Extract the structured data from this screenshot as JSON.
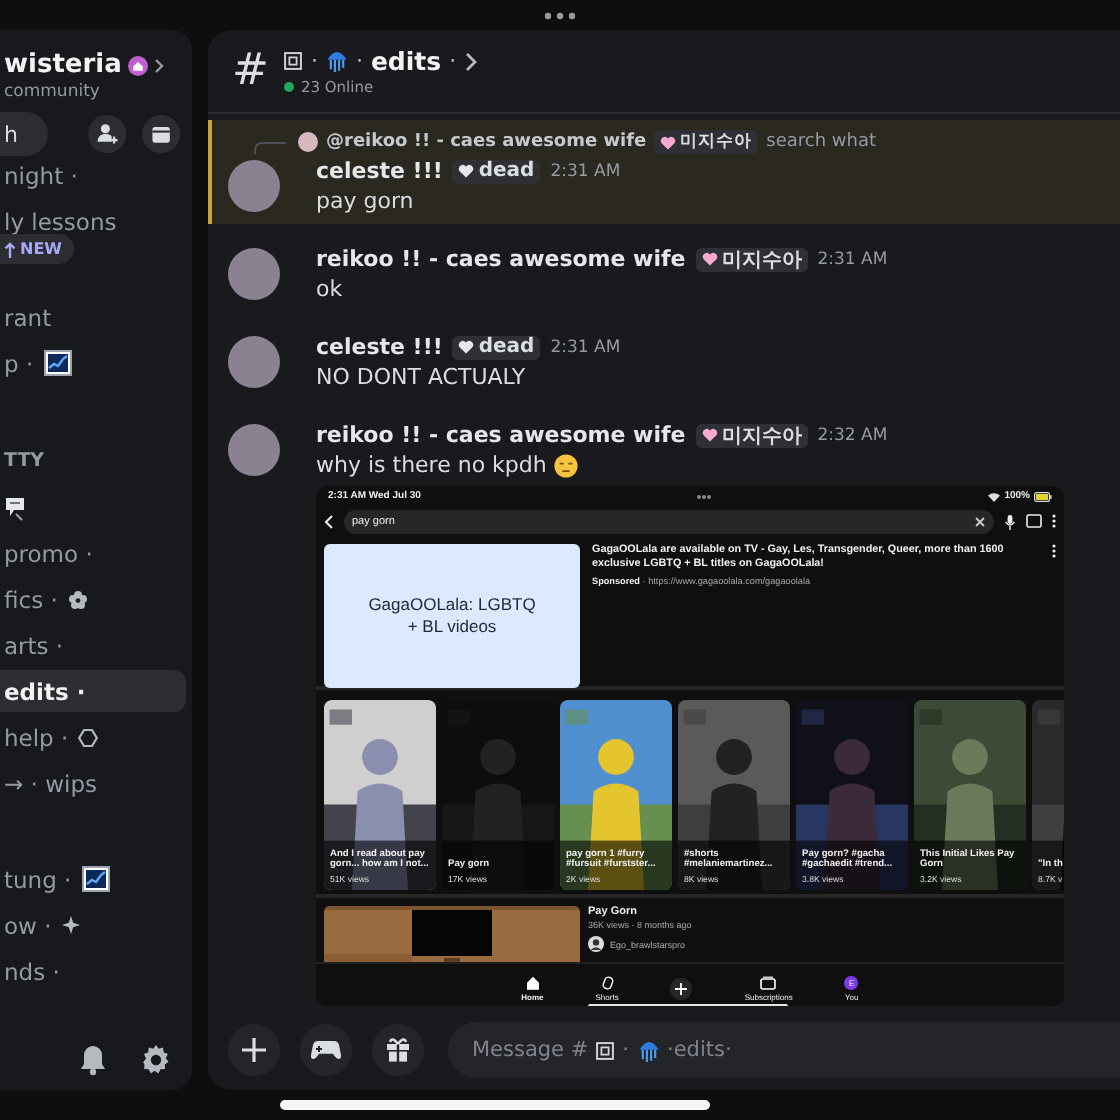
{
  "sidebar": {
    "server_name": "wisteria",
    "server_subtitle": "community",
    "search_label": "h",
    "new_badge": "NEW",
    "groups": [
      {
        "items": [
          {
            "kind": "text",
            "label": "night ·",
            "selected": false
          },
          {
            "kind": "text",
            "label": "ly lessons",
            "selected": false
          }
        ]
      },
      {
        "items": [
          {
            "kind": "text",
            "label": "rant",
            "selected": false
          },
          {
            "kind": "chart",
            "label": "p ·",
            "selected": false
          }
        ]
      },
      {
        "category": "TTY",
        "items": [
          {
            "kind": "sticker",
            "selected": false
          },
          {
            "kind": "text",
            "label": "promo ·",
            "selected": false
          },
          {
            "kind": "flower",
            "label": "fics ·",
            "selected": false
          },
          {
            "kind": "text",
            "label": "arts ·",
            "selected": false
          },
          {
            "kind": "text",
            "label": "edits ·",
            "selected": true
          },
          {
            "kind": "hexagon",
            "label": "help ·",
            "selected": false
          },
          {
            "kind": "text",
            "label": "→ · wips",
            "selected": false
          }
        ]
      },
      {
        "items": [
          {
            "kind": "chart",
            "label": "tung ·",
            "selected": false
          },
          {
            "kind": "sparkle",
            "label": "ow ·",
            "selected": false
          },
          {
            "kind": "text",
            "label": "nds ·",
            "selected": false
          }
        ]
      }
    ]
  },
  "header": {
    "hash": "#",
    "title_parts": [
      {
        "kind": "square"
      },
      {
        "kind": "text",
        "text": "·"
      },
      {
        "kind": "jellyfish"
      },
      {
        "kind": "text",
        "text": "·"
      },
      {
        "kind": "strong",
        "text": "edits"
      },
      {
        "kind": "text",
        "text": "·"
      },
      {
        "kind": "chevron"
      }
    ],
    "online": "23 Online"
  },
  "messages": [
    {
      "author": "celeste !!!",
      "tag": {
        "text": "dead",
        "color": "#e5e7eb"
      },
      "time": "2:31 AM",
      "text": "pay gorn",
      "highlighted": true,
      "reply": {
        "author": "@reikoo !! - caes awesome wife",
        "tag": {
          "text": "미지수아",
          "color": "#f9a8d4"
        },
        "text": "search what"
      }
    },
    {
      "author": "reikoo !! - caes awesome wife",
      "tag": {
        "text": "미지수아",
        "color": "#f9a8d4"
      },
      "time": "2:31 AM",
      "text": "ok",
      "highlighted": false
    },
    {
      "author": "celeste !!!",
      "tag": {
        "text": "dead",
        "color": "#e5e7eb"
      },
      "time": "2:31 AM",
      "text": "NO DONT ACTUALY",
      "highlighted": false
    },
    {
      "author": "reikoo !! - caes awesome wife",
      "tag": {
        "text": "미지수아",
        "color": "#f9a8d4"
      },
      "time": "2:32 AM",
      "text": "why is there no kpdh",
      "trailing_emoji": true,
      "highlighted": false,
      "attachment": {
        "status_time": "2:31 AM  Wed Jul 30",
        "battery": "100%",
        "search_query": "pay gorn",
        "ad": {
          "thumb_text": "GagaOOLala: LGBTQ + BL videos",
          "title": "GagaOOLala are available on TV - Gay, Les, Transgender, Queer, more than 1600 exclusive LGBTQ + BL titles on GagaOOLala!",
          "sponsored": "Sponsored",
          "url": "· https://www.gagaoolala.com/gagaoolala"
        },
        "shorts": [
          {
            "title": "And I read about pay gorn... how am I not...",
            "views": "51K views"
          },
          {
            "title": "Pay gorn",
            "views": "17K views"
          },
          {
            "title": "pay gorn 1 #furry #fursuit #furstster...",
            "views": "2K views"
          },
          {
            "title": "#shorts #melaniemartinez...",
            "views": "8K views"
          },
          {
            "title": "Pay gorn? #gacha #gachaedit #trend...",
            "views": "3.8K views"
          },
          {
            "title": "This Initial Likes Pay Gorn",
            "views": "3.2K views"
          },
          {
            "title": "\"In th",
            "views": "8.7K v"
          }
        ],
        "video": {
          "title": "Pay Gorn",
          "meta": "36K views · 8 months ago",
          "channel": "Ego_brawlstarspro"
        },
        "nav": [
          {
            "kind": "home",
            "label": "Home",
            "selected": true
          },
          {
            "kind": "shorts",
            "label": "Shorts",
            "selected": false
          },
          {
            "kind": "plus",
            "selected": false
          },
          {
            "kind": "subs",
            "label": "Subscriptions",
            "selected": false
          },
          {
            "kind": "you",
            "label": "You",
            "letter": "E",
            "selected": false
          }
        ]
      }
    }
  ],
  "composer": {
    "placeholder_parts": [
      {
        "kind": "text",
        "text": "Message #"
      },
      {
        "kind": "square"
      },
      {
        "kind": "text",
        "text": "·"
      },
      {
        "kind": "jellyfish"
      },
      {
        "kind": "text",
        "text": "·"
      },
      {
        "kind": "text",
        "text": "edits"
      },
      {
        "kind": "text",
        "text": "·"
      }
    ]
  }
}
